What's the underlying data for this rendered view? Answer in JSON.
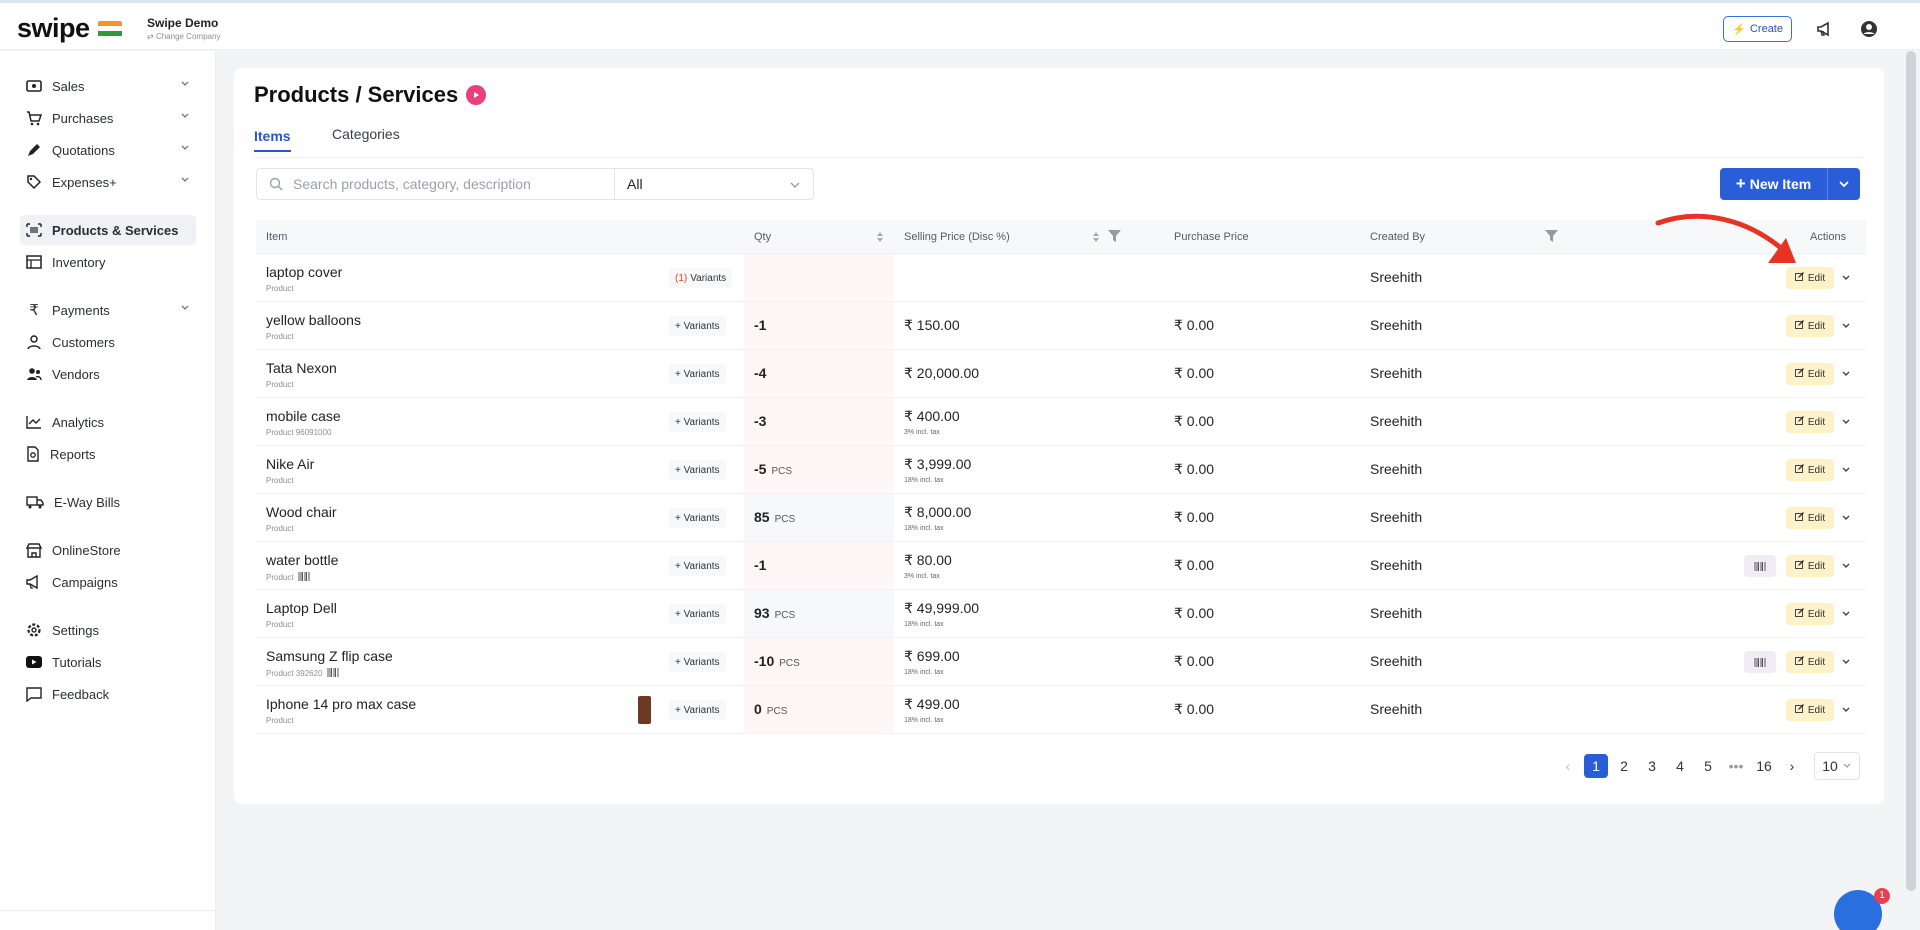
{
  "app": {
    "logo": "swipe",
    "company_name": "Swipe Demo",
    "change_company": "Change Company",
    "create_label": "Create",
    "accent": "#2a5ed9"
  },
  "sidebar": {
    "items": [
      {
        "label": "Sales",
        "icon": "sales-icon",
        "has_chevron": true
      },
      {
        "label": "Purchases",
        "icon": "cart-icon",
        "has_chevron": true
      },
      {
        "label": "Quotations",
        "icon": "pen-icon",
        "has_chevron": true
      },
      {
        "label": "Expenses+",
        "icon": "tag-icon",
        "has_chevron": true
      },
      {
        "label": "Products & Services",
        "icon": "barcode-icon",
        "active": true
      },
      {
        "label": "Inventory",
        "icon": "inventory-icon"
      },
      {
        "label": "Payments",
        "icon": "rupee-icon",
        "has_chevron": true
      },
      {
        "label": "Customers",
        "icon": "user-icon"
      },
      {
        "label": "Vendors",
        "icon": "users-icon"
      },
      {
        "label": "Analytics",
        "icon": "analytics-icon"
      },
      {
        "label": "Reports",
        "icon": "report-icon"
      },
      {
        "label": "E-Way Bills",
        "icon": "truck-icon"
      },
      {
        "label": "OnlineStore",
        "icon": "store-icon"
      },
      {
        "label": "Campaigns",
        "icon": "megaphone-icon"
      },
      {
        "label": "Settings",
        "icon": "gear-icon"
      },
      {
        "label": "Tutorials",
        "icon": "youtube-icon"
      },
      {
        "label": "Feedback",
        "icon": "chat-icon"
      }
    ]
  },
  "page": {
    "title": "Products / Services",
    "tabs": [
      {
        "label": "Items",
        "active": true
      },
      {
        "label": "Categories",
        "active": false
      }
    ],
    "search_placeholder": "Search products, category, description",
    "filter_value": "All",
    "new_item_label": "New Item"
  },
  "table": {
    "headers": [
      "Item",
      "Qty",
      "Selling Price (Disc %)",
      "Purchase Price",
      "Created By",
      "Actions"
    ],
    "rows": [
      {
        "name": "laptop cover",
        "sub": "Product",
        "variants": "Variants",
        "variant_count": "(1)",
        "qty": "",
        "unit": "",
        "price": "",
        "price_sub": "",
        "purchase": "",
        "created_by": "Sreehith",
        "qty_tone": "neg",
        "barcode": false,
        "sub_barcode": false,
        "thumb": false
      },
      {
        "name": "yellow balloons",
        "sub": "Product",
        "variants": "+ Variants",
        "qty": "-1",
        "unit": "",
        "price": "₹ 150.00",
        "price_sub": "",
        "purchase": "₹ 0.00",
        "created_by": "Sreehith",
        "qty_tone": "neg",
        "barcode": false,
        "sub_barcode": false,
        "thumb": false
      },
      {
        "name": "Tata Nexon",
        "sub": "Product",
        "variants": "+ Variants",
        "qty": "-4",
        "unit": "",
        "price": "₹ 20,000.00",
        "price_sub": "",
        "purchase": "₹ 0.00",
        "created_by": "Sreehith",
        "qty_tone": "neg",
        "barcode": false,
        "sub_barcode": false,
        "thumb": false
      },
      {
        "name": "mobile case",
        "sub": "Product   96091000",
        "variants": "+ Variants",
        "qty": "-3",
        "unit": "",
        "price": "₹ 400.00",
        "price_sub": "3% incl. tax",
        "purchase": "₹ 0.00",
        "created_by": "Sreehith",
        "qty_tone": "neg",
        "barcode": false,
        "sub_barcode": false,
        "thumb": false
      },
      {
        "name": "Nike Air",
        "sub": "Product",
        "variants": "+ Variants",
        "qty": "-5",
        "unit": "PCS",
        "price": "₹ 3,999.00",
        "price_sub": "18% incl. tax",
        "purchase": "₹ 0.00",
        "created_by": "Sreehith",
        "qty_tone": "neg",
        "barcode": false,
        "sub_barcode": false,
        "thumb": false
      },
      {
        "name": "Wood chair",
        "sub": "Product",
        "variants": "+ Variants",
        "qty": "85",
        "unit": "PCS",
        "price": "₹ 8,000.00",
        "price_sub": "18% incl. tax",
        "purchase": "₹ 0.00",
        "created_by": "Sreehith",
        "qty_tone": "pos",
        "barcode": false,
        "sub_barcode": false,
        "thumb": false
      },
      {
        "name": "water bottle",
        "sub": "Product",
        "variants": "+ Variants",
        "qty": "-1",
        "unit": "",
        "price": "₹ 80.00",
        "price_sub": "3% incl. tax",
        "purchase": "₹ 0.00",
        "created_by": "Sreehith",
        "qty_tone": "neg",
        "barcode": true,
        "sub_barcode": true,
        "thumb": false
      },
      {
        "name": "Laptop Dell",
        "sub": "Product",
        "variants": "+ Variants",
        "qty": "93",
        "unit": "PCS",
        "price": "₹ 49,999.00",
        "price_sub": "18% incl. tax",
        "purchase": "₹ 0.00",
        "created_by": "Sreehith",
        "qty_tone": "pos",
        "barcode": false,
        "sub_barcode": false,
        "thumb": false
      },
      {
        "name": "Samsung Z flip case",
        "sub": "Product   392620",
        "variants": "+ Variants",
        "qty": "-10",
        "unit": "PCS",
        "price": "₹ 699.00",
        "price_sub": "18% incl. tax",
        "purchase": "₹ 0.00",
        "created_by": "Sreehith",
        "qty_tone": "neg",
        "barcode": true,
        "sub_barcode": true,
        "thumb": false
      },
      {
        "name": "Iphone 14 pro max case",
        "sub": "Product",
        "variants": "+ Variants",
        "qty": "0",
        "unit": "PCS",
        "price": "₹ 499.00",
        "price_sub": "18% incl. tax",
        "purchase": "₹ 0.00",
        "created_by": "Sreehith",
        "qty_tone": "zero",
        "barcode": false,
        "sub_barcode": false,
        "thumb": true
      }
    ],
    "edit_label": "Edit"
  },
  "pagination": {
    "pages": [
      "1",
      "2",
      "3",
      "4",
      "5",
      "•••",
      "16"
    ],
    "current": "1",
    "page_size": "10"
  },
  "chat_badge": "1",
  "annotation": {
    "arrow_color": "#e53424"
  }
}
